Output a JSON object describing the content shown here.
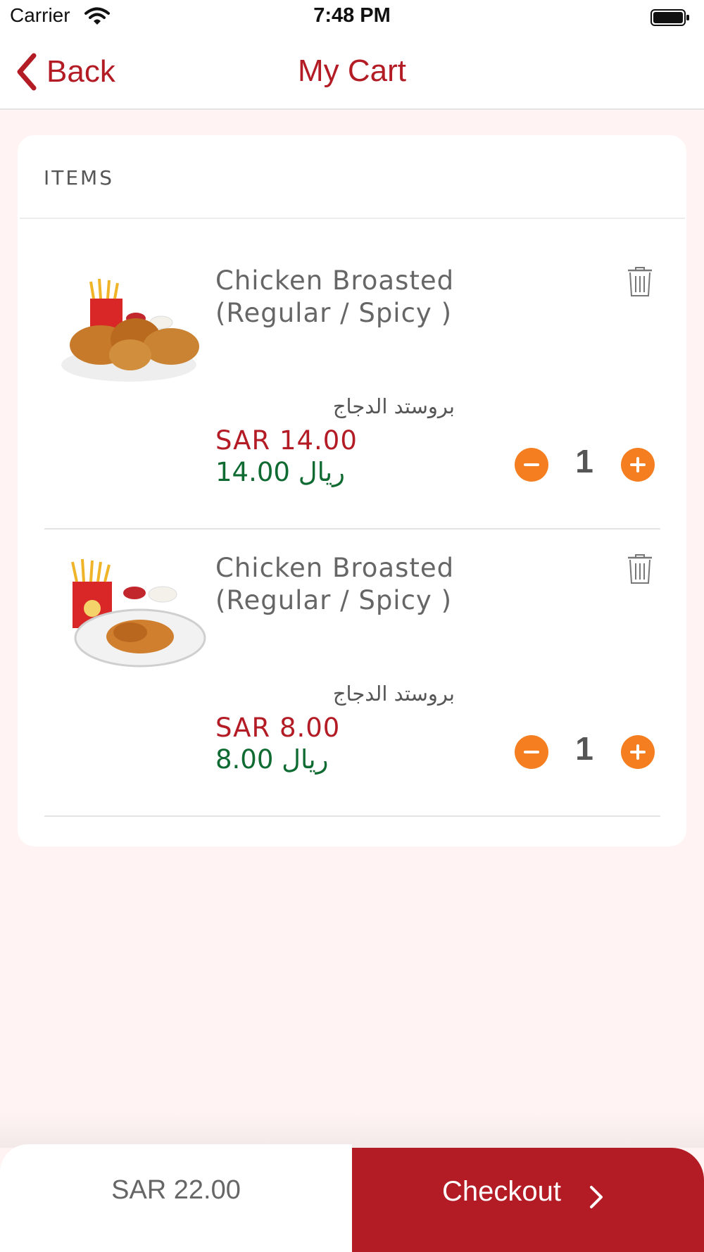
{
  "status_bar": {
    "carrier": "Carrier",
    "time": "7:48 PM"
  },
  "nav": {
    "back_label": "Back",
    "title": "My Cart"
  },
  "cart": {
    "section_header": "ITEMS",
    "items": [
      {
        "name": "Chicken Broasted (Regular / Spicy )",
        "name_ar": "بروستد الدجاج",
        "price": "SAR 14.00",
        "price_ar": "14.00 ريال",
        "quantity": "1",
        "image": "broasted-chicken-meal-photo"
      },
      {
        "name": "Chicken Broasted (Regular / Spicy )",
        "name_ar": "بروستد الدجاج",
        "price": "SAR 8.00",
        "price_ar": "8.00 ريال",
        "quantity": "1",
        "image": "broasted-chicken-plate-photo"
      }
    ]
  },
  "footer": {
    "total": "SAR 22.00",
    "checkout_label": "Checkout"
  },
  "colors": {
    "brand_red": "#b31b25",
    "stepper_orange": "#f47e20",
    "arabic_price_green": "#0f6b32"
  }
}
